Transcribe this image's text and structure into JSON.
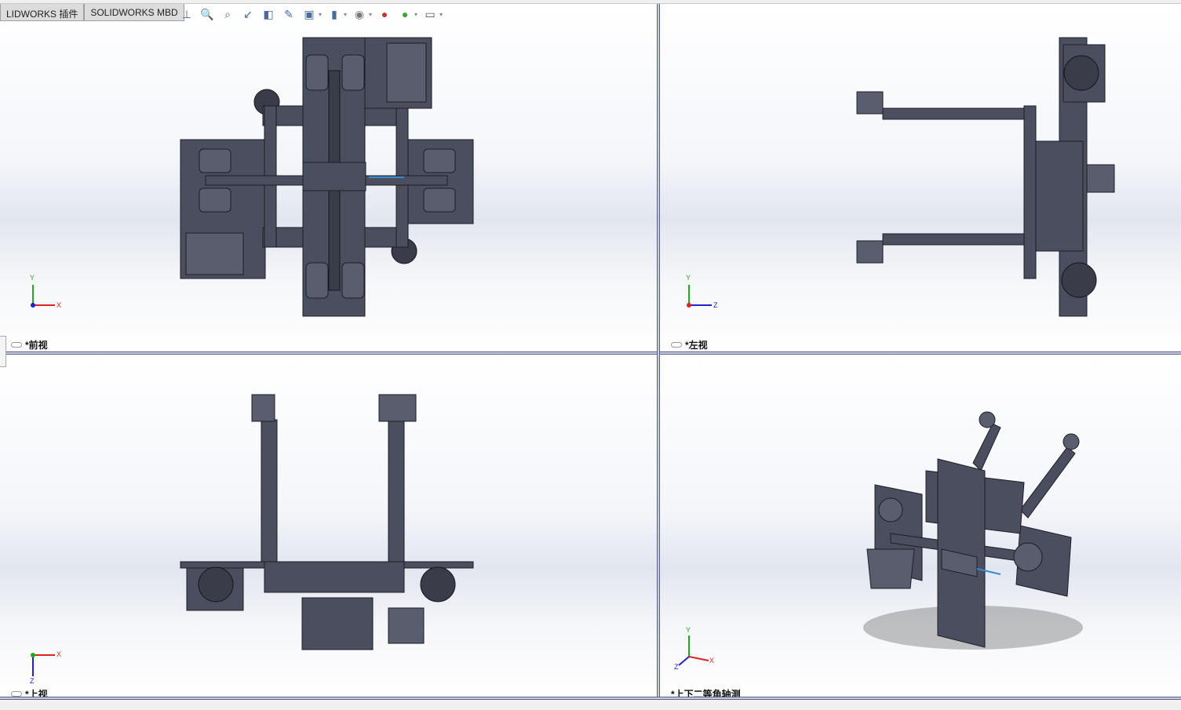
{
  "tabs": [
    {
      "label": "LIDWORKS 插件"
    },
    {
      "label": "SOLIDWORKS MBD"
    }
  ],
  "toolbar": {
    "icons": [
      "normal-to-icon",
      "zoom-to-fit-icon",
      "zoom-to-area-icon",
      "previous-view-icon",
      "section-view-icon",
      "dynamic-annotation-icon",
      "view-orientation-icon",
      "display-style-icon",
      "hide-show-items-icon",
      "edit-appearance-icon",
      "apply-scene-icon",
      "view-settings-icon"
    ]
  },
  "viewports": [
    {
      "label": "*前视",
      "axes": [
        "Y",
        "X"
      ]
    },
    {
      "label": "*左视",
      "axes": [
        "Y",
        "Z"
      ]
    },
    {
      "label": "*上视",
      "axes": [
        "X",
        "Z"
      ]
    },
    {
      "label": "*上下二等角轴测",
      "axes": [
        "Y",
        "X",
        "Z"
      ]
    }
  ],
  "colors": {
    "part": "#4b4e5e",
    "edge": "#1c1d26",
    "separator": "#5b6090"
  }
}
